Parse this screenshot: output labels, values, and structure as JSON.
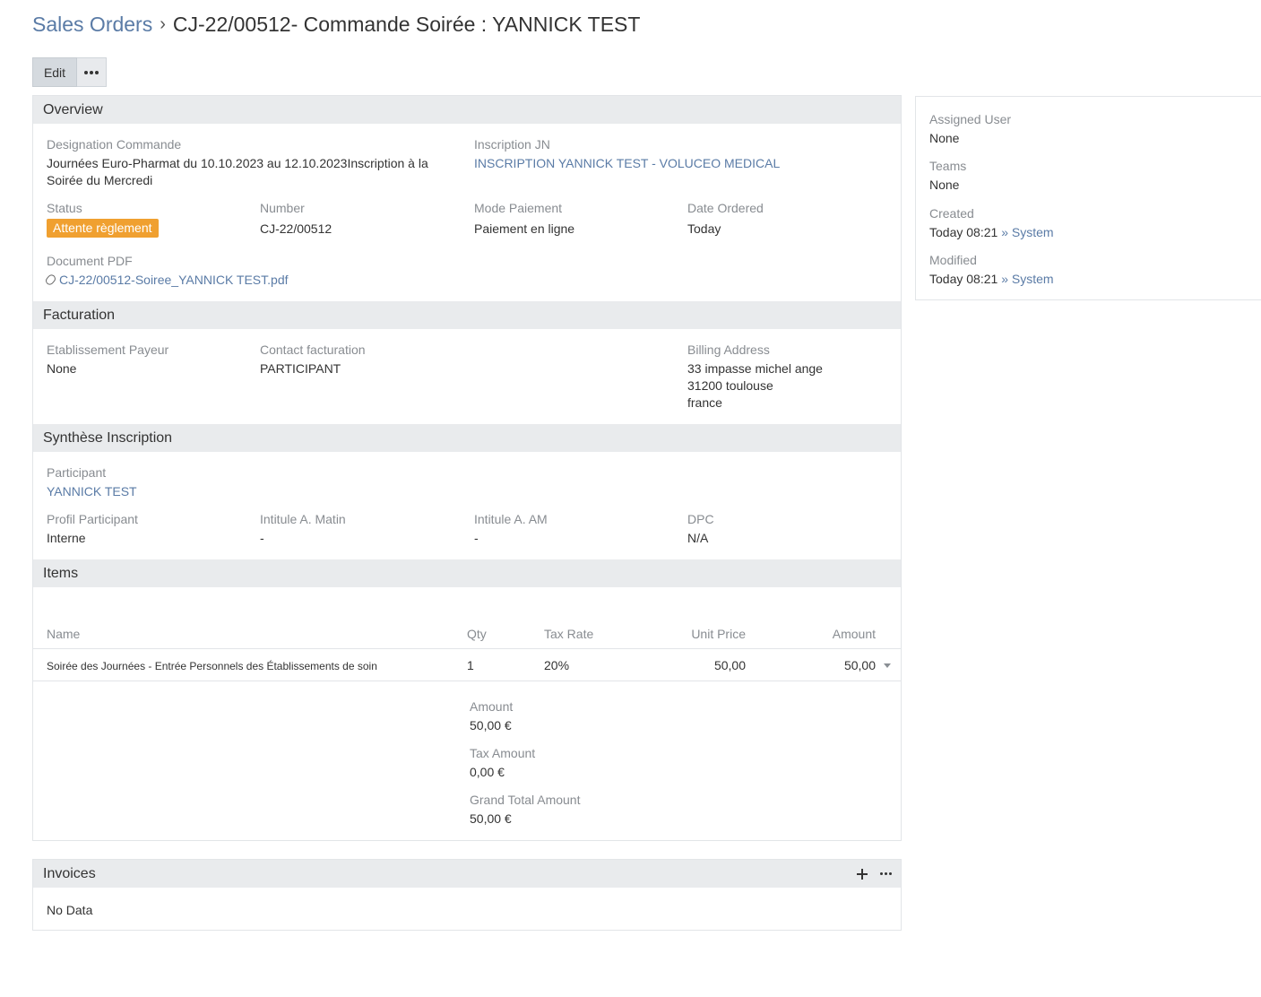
{
  "header": {
    "breadcrumb": "Sales Orders",
    "separator": "›",
    "title": "CJ-22/00512- Commande Soirée : YANNICK TEST"
  },
  "toolbar": {
    "edit_label": "Edit",
    "more_icon": "ellipsis-icon"
  },
  "overview": {
    "title": "Overview",
    "designation": {
      "label": "Designation Commande",
      "value": "Journées Euro-Pharmat du 10.10.2023 au 12.10.2023Inscription à la Soirée du Mercredi"
    },
    "inscription": {
      "label": "Inscription JN",
      "value": "INSCRIPTION YANNICK TEST - VOLUCEO MEDICAL"
    },
    "status": {
      "label": "Status",
      "value": "Attente règlement",
      "color": "#f0a030"
    },
    "number": {
      "label": "Number",
      "value": "CJ-22/00512"
    },
    "mode_paiement": {
      "label": "Mode Paiement",
      "value": "Paiement en ligne"
    },
    "date_ordered": {
      "label": "Date Ordered",
      "value": "Today"
    },
    "document_pdf": {
      "label": "Document PDF",
      "value": "CJ-22/00512-Soiree_YANNICK TEST.pdf",
      "icon": "paperclip-icon"
    }
  },
  "facturation": {
    "title": "Facturation",
    "etablissement": {
      "label": "Etablissement Payeur",
      "value": "None"
    },
    "contact": {
      "label": "Contact facturation",
      "value": "PARTICIPANT"
    },
    "billing": {
      "label": "Billing Address",
      "line1": "33 impasse michel ange",
      "line2": "31200 toulouse",
      "line3": "france"
    }
  },
  "synthese": {
    "title": "Synthèse Inscription",
    "participant": {
      "label": "Participant",
      "value": "YANNICK TEST"
    },
    "profil": {
      "label": "Profil Participant",
      "value": "Interne"
    },
    "matin": {
      "label": "Intitule A. Matin",
      "value": "-"
    },
    "am": {
      "label": "Intitule A. AM",
      "value": "-"
    },
    "dpc": {
      "label": "DPC",
      "value": "N/A"
    }
  },
  "items": {
    "title": "Items",
    "columns": {
      "name": "Name",
      "qty": "Qty",
      "tax": "Tax Rate",
      "unit": "Unit Price",
      "amount": "Amount"
    },
    "rows": [
      {
        "name": "Soirée des Journées - Entrée Personnels des Établissements de soin",
        "qty": "1",
        "tax": "20%",
        "unit": "50,00",
        "amount": "50,00"
      }
    ],
    "totals": {
      "amount": {
        "label": "Amount",
        "value": "50,00 €"
      },
      "tax": {
        "label": "Tax Amount",
        "value": "0,00 €"
      },
      "grand": {
        "label": "Grand Total Amount",
        "value": "50,00 €"
      }
    }
  },
  "side": {
    "assigned": {
      "label": "Assigned User",
      "value": "None"
    },
    "teams": {
      "label": "Teams",
      "value": "None"
    },
    "created": {
      "label": "Created",
      "time": "Today 08:21",
      "by_sep": "»",
      "by": "System"
    },
    "modified": {
      "label": "Modified",
      "time": "Today 08:21",
      "by_sep": "»",
      "by": "System"
    }
  },
  "invoices": {
    "title": "Invoices",
    "empty": "No Data",
    "add_icon": "plus-icon",
    "more_icon": "ellipsis-icon"
  }
}
